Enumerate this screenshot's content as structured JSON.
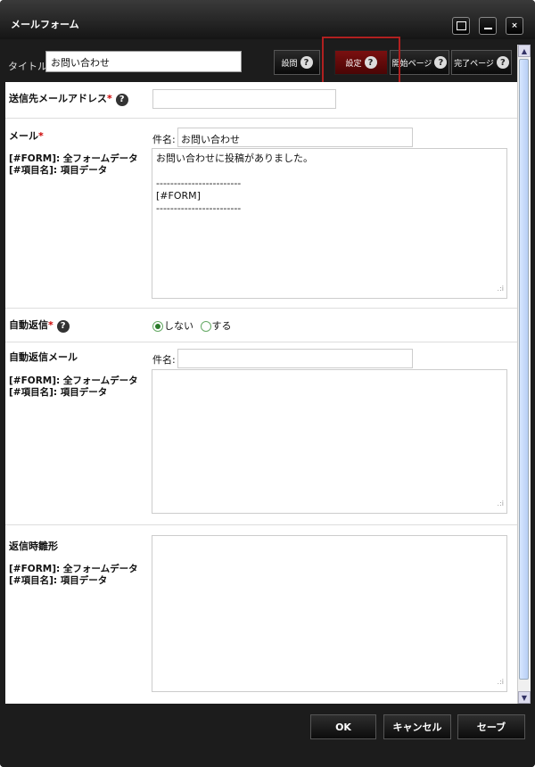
{
  "window": {
    "title": "メールフォーム"
  },
  "toolbar": {
    "title_label": "タイトル:",
    "title_value": "お問い合わせ",
    "buttons": [
      "設問",
      "設定",
      "開始ページ",
      "完了ページ"
    ]
  },
  "fields": {
    "sender": {
      "label": "送信先メールアドレス",
      "required": "*",
      "value": ""
    },
    "mail": {
      "label": "メール",
      "required": "*",
      "hint1": "[#FORM]: 全フォームデータ",
      "hint2": "[#項目名]: 項目データ",
      "subject_label": "件名:",
      "subject_value": "お問い合わせ",
      "body": "お問い合わせに投稿がありました。\n\n------------------------\n[#FORM]\n------------------------"
    },
    "auto_reply": {
      "label": "自動返信",
      "required": "*",
      "options": [
        "しない",
        "する"
      ],
      "selected": "しない"
    },
    "auto_reply_mail": {
      "label": "自動返信メール",
      "hint1": "[#FORM]: 全フォームデータ",
      "hint2": "[#項目名]: 項目データ",
      "subject_label": "件名:",
      "subject_value": "",
      "body": ""
    },
    "reply_template": {
      "label": "返信時雛形",
      "hint1": "[#FORM]: 全フォームデータ",
      "hint2": "[#項目名]: 項目データ",
      "body": ""
    }
  },
  "footer": {
    "ok": "OK",
    "cancel": "キャンセル",
    "save": "セーブ"
  },
  "colors": {
    "accent": "#6a0c0c",
    "highlight": "#b02020"
  }
}
